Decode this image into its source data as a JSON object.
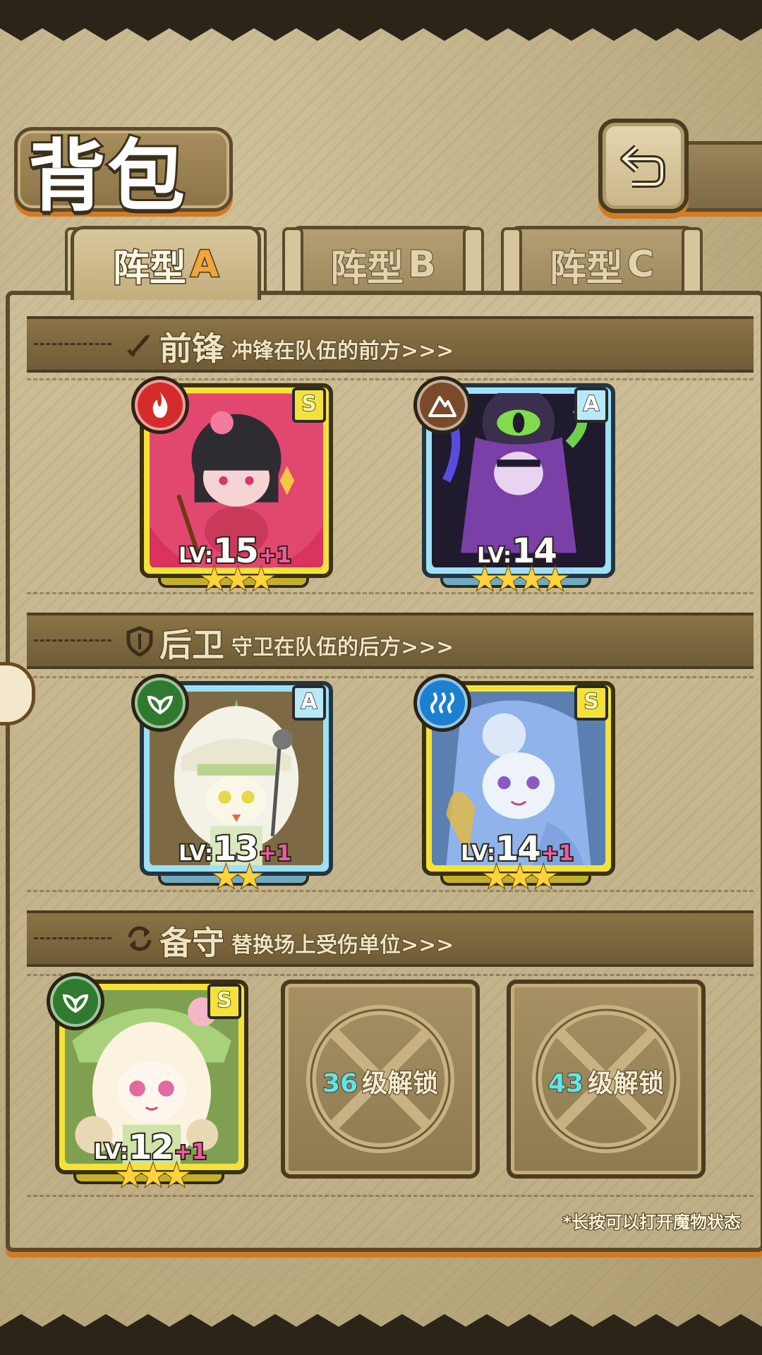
{
  "screen": {
    "title": "背包"
  },
  "tabs": [
    {
      "prefix": "阵型",
      "suffix": "A",
      "active": true
    },
    {
      "prefix": "阵型",
      "suffix": "B",
      "active": false
    },
    {
      "prefix": "阵型",
      "suffix": "C",
      "active": false
    }
  ],
  "sections": {
    "front": {
      "icon": "sword-icon",
      "title": "前锋",
      "desc": "冲锋在队伍的前方>>>"
    },
    "back": {
      "icon": "shield-icon",
      "title": "后卫",
      "desc": "守卫在队伍的后方>>>"
    },
    "reserve": {
      "icon": "swap-icon",
      "title": "备守",
      "desc": "替换场上受伤单位>>>"
    }
  },
  "monsters": {
    "front_1": {
      "rank": "S",
      "element": "fire",
      "element_color": "#d42b2b",
      "lv_prefix": "LV:",
      "level": "15",
      "bonus": "+1",
      "stars": "★★★",
      "star_count": 3
    },
    "front_2": {
      "rank": "A",
      "element": "earth",
      "element_color": "#7a4a2a",
      "lv_prefix": "LV:",
      "level": "14",
      "bonus": "",
      "stars": "★★★★",
      "star_count": 4
    },
    "back_1": {
      "rank": "A",
      "element": "leaf",
      "element_color": "#2f7a2f",
      "lv_prefix": "LV:",
      "level": "13",
      "bonus": "+1",
      "stars": "★★",
      "star_count": 2
    },
    "back_2": {
      "rank": "S",
      "element": "water",
      "element_color": "#1d7fd0",
      "lv_prefix": "LV:",
      "level": "14",
      "bonus": "+1",
      "stars": "★★★",
      "star_count": 3
    },
    "reserve_1": {
      "rank": "S",
      "element": "leaf",
      "element_color": "#2f7a2f",
      "lv_prefix": "LV:",
      "level": "12",
      "bonus": "+1",
      "stars": "★★★",
      "star_count": 3
    }
  },
  "locked_slots": [
    {
      "level": "36",
      "label": "级解锁"
    },
    {
      "level": "43",
      "label": "级解锁"
    }
  ],
  "hint": "*长按可以打开魔物状态",
  "colors": {
    "accent_orange": "#d47a24",
    "frame_dark": "#5b4a2c",
    "parchment": "#c9b88f"
  }
}
